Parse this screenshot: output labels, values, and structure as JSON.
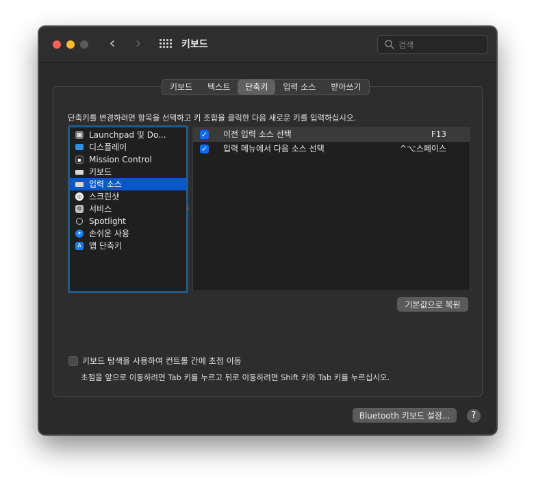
{
  "window": {
    "title": "키보드",
    "search_placeholder": "검색"
  },
  "tabs": [
    {
      "label": "키보드"
    },
    {
      "label": "텍스트"
    },
    {
      "label": "단축키",
      "active": true
    },
    {
      "label": "입력 소스"
    },
    {
      "label": "받아쓰기"
    }
  ],
  "instruction": "단축키를 변경하려면 항목을 선택하고 키 조합을 클릭한 다음 새로운 키를 입력하십시오.",
  "categories": [
    {
      "label": "Launchpad 및 Do...",
      "icon": "launchpad-icon",
      "color": "#7a7a7a"
    },
    {
      "label": "디스플레이",
      "icon": "display-icon",
      "color": "#2f8fe0"
    },
    {
      "label": "Mission Control",
      "icon": "mission-control-icon",
      "color": "#333333"
    },
    {
      "label": "키보드",
      "icon": "keyboard-icon",
      "color": "#d8d8d8"
    },
    {
      "label": "입력 소스",
      "icon": "input-source-icon",
      "color": "#d8d8d8",
      "selected": true
    },
    {
      "label": "스크린샷",
      "icon": "screenshot-icon",
      "color": "#ffffff"
    },
    {
      "label": "서비스",
      "icon": "gear-icon",
      "color": "#bdbdbd"
    },
    {
      "label": "Spotlight",
      "icon": "spotlight-icon",
      "color": "#1f1f1f"
    },
    {
      "label": "손쉬운 사용",
      "icon": "accessibility-icon",
      "color": "#1e7be8"
    },
    {
      "label": "앱 단축키",
      "icon": "app-store-icon",
      "color": "#1e7be8"
    }
  ],
  "shortcuts": [
    {
      "label": "이전 입력 소스 선택",
      "key": "F13",
      "checked": true
    },
    {
      "label": "입력 메뉴에서 다음 소스 선택",
      "key": "^⌥스페이스",
      "checked": true
    }
  ],
  "buttons": {
    "restore": "기본값으로 복원",
    "bluetooth": "Bluetooth 키보드 설정...",
    "help": "?"
  },
  "keyboard_navigation": {
    "label": "키보드 탐색을 사용하여 컨트롤 간에 초점 이동",
    "help": "초점을 앞으로 이동하려면 Tab 키를 누르고 뒤로 이동하려면 Shift 키와 Tab 키를 누르십시오.",
    "checked": false
  },
  "colors": {
    "accent": "#0a57c9",
    "checkbox": "#0a6cf5",
    "focus_ring": "#235a8a"
  }
}
